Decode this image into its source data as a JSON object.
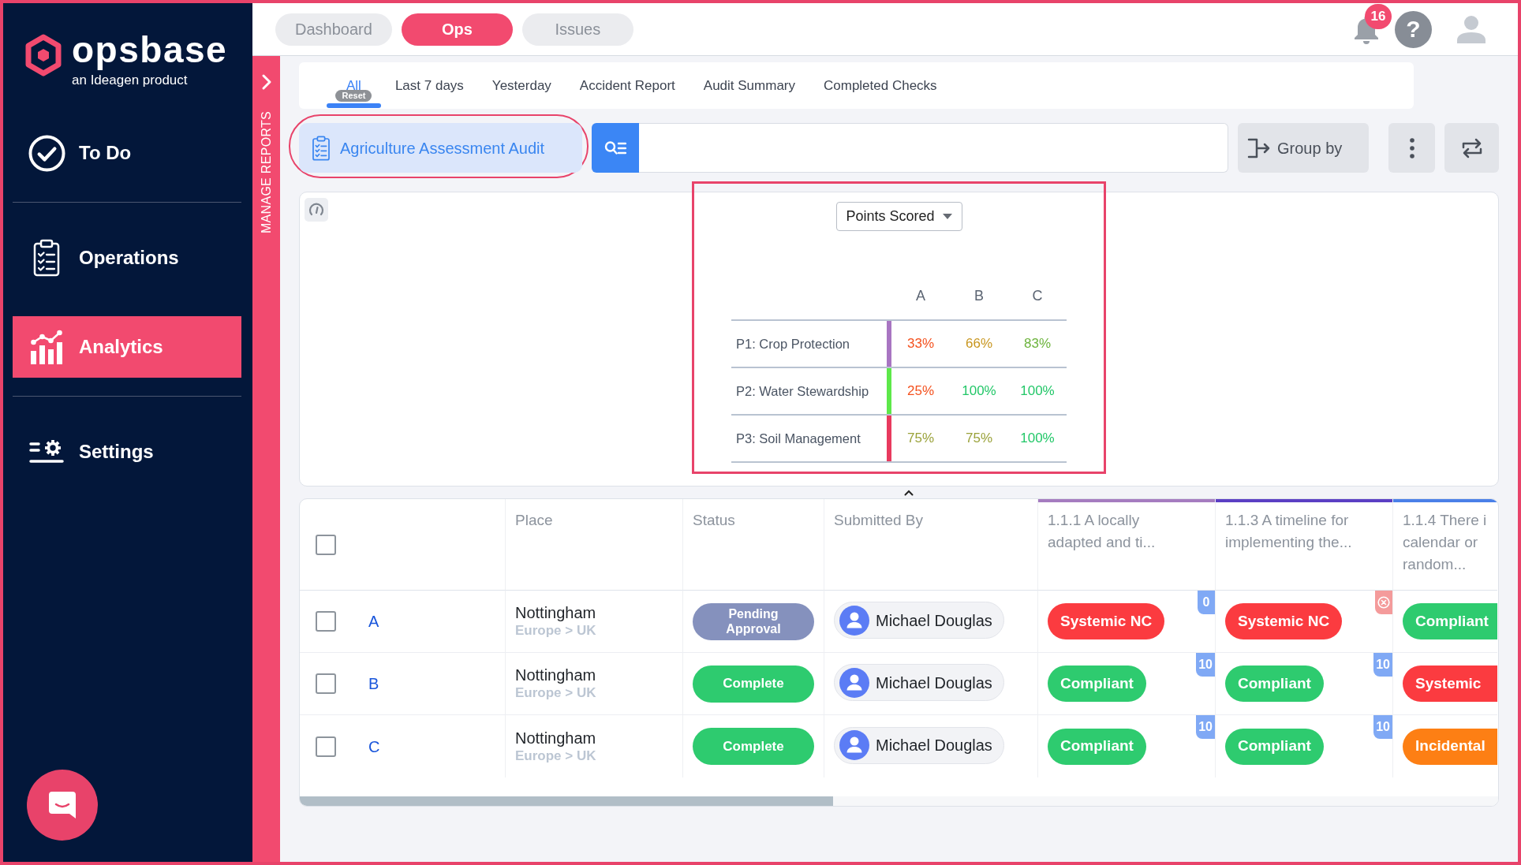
{
  "sidebar": {
    "logo": {
      "wordmark": "opsbase",
      "tagline": "an Ideagen product"
    },
    "groups": [
      {
        "items": [
          {
            "label": "To Do",
            "selected": false
          }
        ]
      },
      {
        "items": [
          {
            "label": "Operations",
            "selected": false
          },
          {
            "label": "Analytics",
            "selected": true
          }
        ]
      },
      {
        "items": [
          {
            "label": "Settings",
            "selected": false
          }
        ]
      }
    ]
  },
  "top_tabs": [
    {
      "label": "Dashboard",
      "selected": false
    },
    {
      "label": "Ops",
      "selected": true
    },
    {
      "label": "Issues",
      "selected": false
    }
  ],
  "header_actions": {
    "notification_count": "16",
    "help_label": "?"
  },
  "manage_reports": {
    "label": "MANAGE REPORTS"
  },
  "filter_tabs": [
    {
      "label": "All",
      "selected": true,
      "badge": "Reset"
    },
    {
      "label": "Last 7 days",
      "selected": false
    },
    {
      "label": "Yesterday",
      "selected": false
    },
    {
      "label": "Accident Report",
      "selected": false
    },
    {
      "label": "Audit Summary",
      "selected": false
    },
    {
      "label": "Completed Checks",
      "selected": false
    }
  ],
  "report_selector": {
    "label": "Agriculture Assessment Audit",
    "highlighted": true
  },
  "toolbar": {
    "group_by": "Group by"
  },
  "score_panel": {
    "highlighted": true,
    "metric": "Points Scored",
    "columns": [
      "A",
      "B",
      "C"
    ],
    "rows": [
      {
        "label": "P1: Crop Protection",
        "color": "#a875c2",
        "values": [
          {
            "text": "33%",
            "color": "#f4511e"
          },
          {
            "text": "66%",
            "color": "#c8961f"
          },
          {
            "text": "83%",
            "color": "#6cb33c"
          }
        ]
      },
      {
        "label": "P2: Water Stewardship",
        "color": "#5de84a",
        "values": [
          {
            "text": "25%",
            "color": "#f4511e"
          },
          {
            "text": "100%",
            "color": "#22c768"
          },
          {
            "text": "100%",
            "color": "#22c768"
          }
        ]
      },
      {
        "label": "P3: Soil Management",
        "color": "#e83a5e",
        "values": [
          {
            "text": "75%",
            "color": "#9aa23a"
          },
          {
            "text": "75%",
            "color": "#9aa23a"
          },
          {
            "text": "100%",
            "color": "#22c768"
          }
        ]
      }
    ]
  },
  "table": {
    "select_all": {
      "checked": false
    },
    "columns": [
      {
        "label": "Place"
      },
      {
        "label": "Status"
      },
      {
        "label": "Submitted By"
      },
      {
        "label": "1.1.1 A locally adapted and ti...",
        "color": "#a57cc0"
      },
      {
        "label": "1.1.3 A timeline for implementing the...",
        "color": "#5b3fc4"
      },
      {
        "label": "1.1.4 There i calendar or random...",
        "color": "#4a80e8"
      }
    ],
    "rows": [
      {
        "checked": false,
        "ref": "A",
        "place": "Nottingham",
        "region": "Europe > UK",
        "status": {
          "kind": "pending",
          "text": "Pending Approval"
        },
        "submitted_by": "Michael Douglas",
        "answers": [
          {
            "kind": "systemic",
            "text": "Systemic NC",
            "flag": {
              "kind": "count",
              "text": "0"
            }
          },
          {
            "kind": "systemic",
            "text": "Systemic NC",
            "flag": {
              "kind": "error"
            }
          },
          {
            "kind": "compliant",
            "text": "Compliant"
          }
        ]
      },
      {
        "checked": false,
        "ref": "B",
        "place": "Nottingham",
        "region": "Europe > UK",
        "status": {
          "kind": "complete",
          "text": "Complete"
        },
        "submitted_by": "Michael Douglas",
        "answers": [
          {
            "kind": "compliant",
            "text": "Compliant",
            "flag": {
              "kind": "count",
              "text": "10"
            }
          },
          {
            "kind": "compliant",
            "text": "Compliant",
            "flag": {
              "kind": "count",
              "text": "10"
            }
          },
          {
            "kind": "systemic",
            "text": "Systemic"
          }
        ]
      },
      {
        "checked": false,
        "ref": "C",
        "place": "Nottingham",
        "region": "Europe > UK",
        "status": {
          "kind": "complete",
          "text": "Complete"
        },
        "submitted_by": "Michael Douglas",
        "answers": [
          {
            "kind": "compliant",
            "text": "Compliant",
            "flag": {
              "kind": "count",
              "text": "10"
            }
          },
          {
            "kind": "compliant",
            "text": "Compliant",
            "flag": {
              "kind": "count",
              "text": "10"
            }
          },
          {
            "kind": "incidental",
            "text": "Incidental"
          }
        ]
      }
    ]
  }
}
